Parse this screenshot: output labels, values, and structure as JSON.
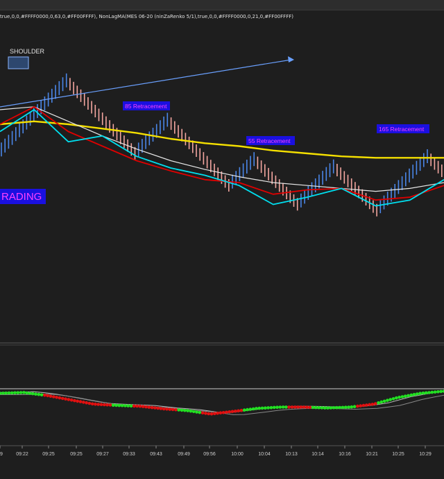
{
  "header": {
    "indicator_text": "true,0,0,#FFFF0000,0,63,0,#FF00FFFF), NonLagMA(MES 06-20 (ninZaRenko 5/1),true,0,0,#FFFF0000,0,21,0,#FF00FFFF)"
  },
  "annotations": {
    "shoulder_label": "SHOULDER",
    "trading_label": "RADING",
    "retracements": [
      "85 Retracement",
      "55 Retracement",
      "165 Retracement"
    ]
  },
  "colors": {
    "background": "#1e1e1e",
    "up_bar": "#4a86e8",
    "down_bar": "#f4a6a0",
    "nonlag_red": "#e00000",
    "nonlag_cyan": "#00e0f0",
    "ma_yellow": "#f5e000",
    "ma_white": "#e8e8e8",
    "trendline": "#6aa0ff",
    "label_bg": "#1a10e0",
    "label_text": "#ff40ff",
    "osc_green": "#22e022",
    "osc_red": "#e01010"
  },
  "chart_data": {
    "type": "line",
    "title": "",
    "x_tick_labels": [
      "9",
      "09:22",
      "09:25",
      "09:25",
      "09:27",
      "09:33",
      "09:43",
      "09:49",
      "09:56",
      "10:00",
      "10:04",
      "10:13",
      "10:14",
      "10:16",
      "10:21",
      "10:25",
      "10:29"
    ],
    "bars_note": "renko bricks, values in relative price units (0 = top of visible range, 100 = bottom)",
    "segments": [
      {
        "dir": "up",
        "from": 58,
        "to": 8
      },
      {
        "dir": "down",
        "from": 8,
        "to": 58
      },
      {
        "dir": "up",
        "from": 58,
        "to": 35
      },
      {
        "dir": "down",
        "from": 35,
        "to": 80
      },
      {
        "dir": "up",
        "from": 80,
        "to": 62
      },
      {
        "dir": "down",
        "from": 62,
        "to": 93
      },
      {
        "dir": "up",
        "from": 93,
        "to": 67
      },
      {
        "dir": "down",
        "from": 67,
        "to": 97
      },
      {
        "dir": "up",
        "from": 97,
        "to": 60
      },
      {
        "dir": "down",
        "from": 60,
        "to": 70
      }
    ],
    "series": [
      {
        "name": "yellow_ma",
        "values": [
          40,
          38,
          40,
          43,
          46,
          50,
          53,
          55,
          58,
          60,
          62,
          63,
          63,
          63
        ]
      },
      {
        "name": "white_ma",
        "values": [
          30,
          28,
          38,
          48,
          57,
          65,
          71,
          76,
          80,
          82,
          84,
          86,
          84,
          80
        ]
      },
      {
        "name": "red_nonlag",
        "values": [
          40,
          28,
          45,
          55,
          65,
          72,
          78,
          80,
          88,
          85,
          84,
          92,
          90,
          82
        ]
      },
      {
        "name": "cyan_nonlag",
        "values": [
          45,
          30,
          52,
          48,
          62,
          70,
          75,
          82,
          95,
          90,
          84,
          96,
          92,
          78
        ]
      }
    ],
    "oscillator": {
      "ylim": [
        0,
        100
      ],
      "values": [
        30,
        28,
        35,
        45,
        55,
        58,
        60,
        66,
        70,
        78,
        72,
        65,
        62,
        62,
        64,
        62,
        55,
        40,
        30,
        25
      ],
      "colors": [
        "green",
        "green",
        "red",
        "red",
        "red",
        "green",
        "red",
        "red",
        "green",
        "red",
        "red",
        "green",
        "green",
        "red",
        "green",
        "green",
        "red",
        "green",
        "green",
        "green"
      ]
    }
  }
}
